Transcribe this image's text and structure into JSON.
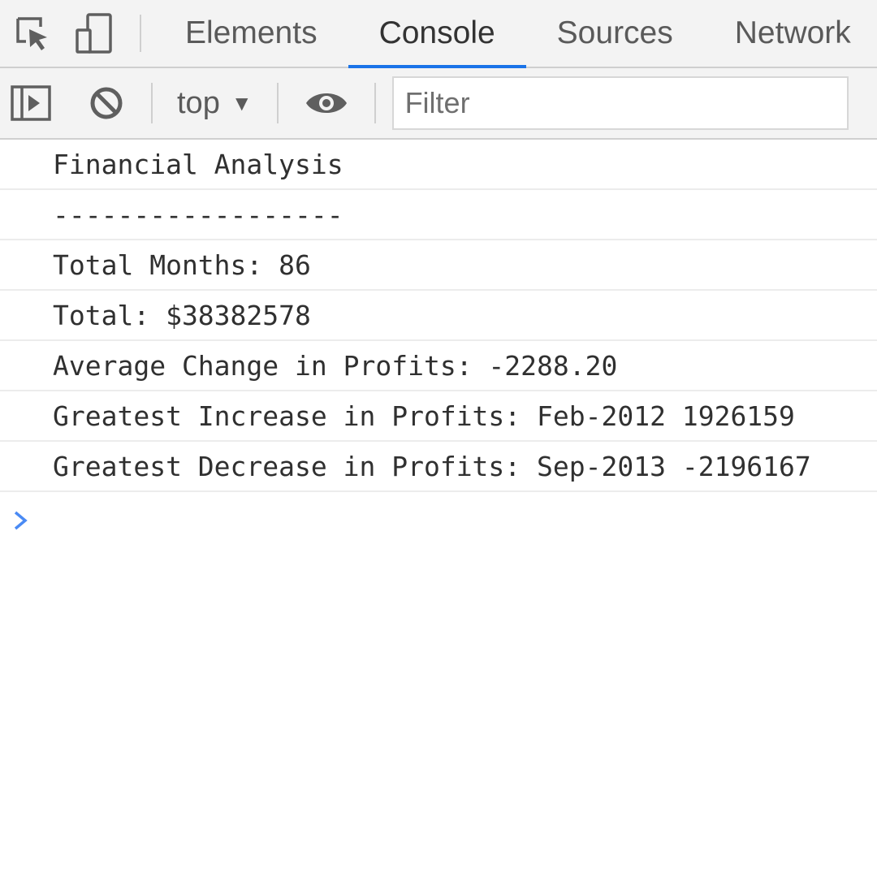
{
  "tabs": [
    {
      "label": "Elements",
      "active": false
    },
    {
      "label": "Console",
      "active": true
    },
    {
      "label": "Sources",
      "active": false
    },
    {
      "label": "Network",
      "active": false
    }
  ],
  "icons": {
    "inspect": "inspect-element-icon",
    "device": "device-toolbar-icon",
    "sidebar": "sidebar-toggle-icon",
    "clear": "clear-console-icon",
    "eye": "live-expression-icon",
    "prompt": "console-prompt-icon"
  },
  "toolbar": {
    "context": "top",
    "caret": "▼",
    "filter_placeholder": "Filter"
  },
  "console": {
    "lines": [
      "Financial Analysis",
      "------------------",
      "Total Months: 86",
      "Total: $38382578",
      "Average Change in Profits: -2288.20",
      "Greatest Increase in Profits: Feb-2012 1926159",
      "Greatest Decrease in Profits: Sep-2013 -2196167"
    ]
  },
  "colors": {
    "accent": "#1a73e8",
    "prompt": "#4a8af4",
    "bar_bg": "#f3f3f3"
  }
}
